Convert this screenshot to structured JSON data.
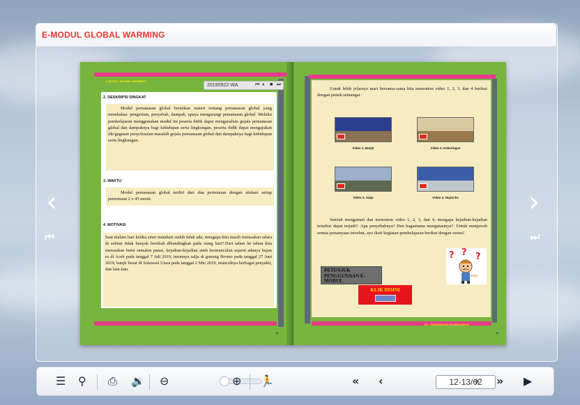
{
  "app": {
    "title": "E-MODUL GLOBAL WARMING"
  },
  "left_page": {
    "header_small": "E-MODUL GLOBAL WARMING",
    "audio": {
      "filename": "20190922-WA",
      "controls": [
        "⏮",
        "⏸",
        "■",
        "⏭"
      ]
    },
    "section2": {
      "heading": "2.  DESKRIPSI SINGKAT",
      "text": "Modul pemanasan global berisikan materi tentang pemanasan global yang membahas: pengertian, penyebab, dampak, upaya mengurangi pemanasan global. Melalui pembelajaran menggunakan modul ini peserta didik dapat menganalisis gejala pemanasan global dan dampaknya bagi kehidupan serta lingkungan, peserta didik dapat mengajukan ide/gagasan penyelesaian masalah gejala pemanasan global dan dampaknya bagi kehidupan serta lingkungan."
    },
    "section3": {
      "heading": "3.  WAKTU",
      "text": "Modul pemanasan global terdiri dari dua pertemuan dengan alokasi setiap pertemuan 2 x 45 menit."
    },
    "section4": {
      "heading": "4.  MOTIVASI",
      "text": "Saat malam hari ketika sinar matahari sudah tidak ada, mengapa kita masih merasakan udara di sekitar tidak banyak berubah dibandingkan pada siang hari?.Dari tahun ke tahun kita merasakan bumi semakin panas, kejadian-kejadian aneh bermunculan seperti adanya hujan es di Aceh pada tanggal 7 Juli 2019, turunnya salju di gunung Bromo pada tanggal 27 Juni 2019, banjir besar di Sulawesi Utara pada tanggal 2 Mei 2019, munculnya berbagai penyakit, dan lain-lain."
    },
    "page_number": "12"
  },
  "right_page": {
    "intro": "Untuk lebih jelasnya mari bersama-sama kita menonton video 1, 2, 3, dan 4 berikut dengan penuh semangat :",
    "videos": [
      {
        "caption": "Video 1. Banjir",
        "sky": "#2c3e8f",
        "ground": "#8b7354"
      },
      {
        "caption": "Video 2. Kekeringan",
        "sky": "#d9c9a3",
        "ground": "#9a7a4a"
      },
      {
        "caption": "Video 3. Salju",
        "sky": "#9bb0c9",
        "ground": "#5c6b4f"
      },
      {
        "caption": "Video 4. Hujan Es",
        "sky": "#3b5ea8",
        "ground": "#c1c7cf"
      }
    ],
    "body": "Setelah mengamati dan menonton video 1, 2, 3, dan 4, mengapa kejadian-kejadian tersebut dapat terjadi?. Apa penyebabnya? Dan bagaimana mengatasinya?. Untuk menjawab semua pertanyaan tersebut, ayo ikuti kegiatan pembelajaran berikut dengan serius!",
    "petunjuk_button": "PETUNJUK PENGGUNAAN E-MODUL",
    "klik_button": "KLIK DISINI",
    "footer_small": "E2 - PEMANASAN GLOBAL/KELS",
    "page_number": "13"
  },
  "toolbar": {
    "page_indicator": "12-13/62"
  }
}
